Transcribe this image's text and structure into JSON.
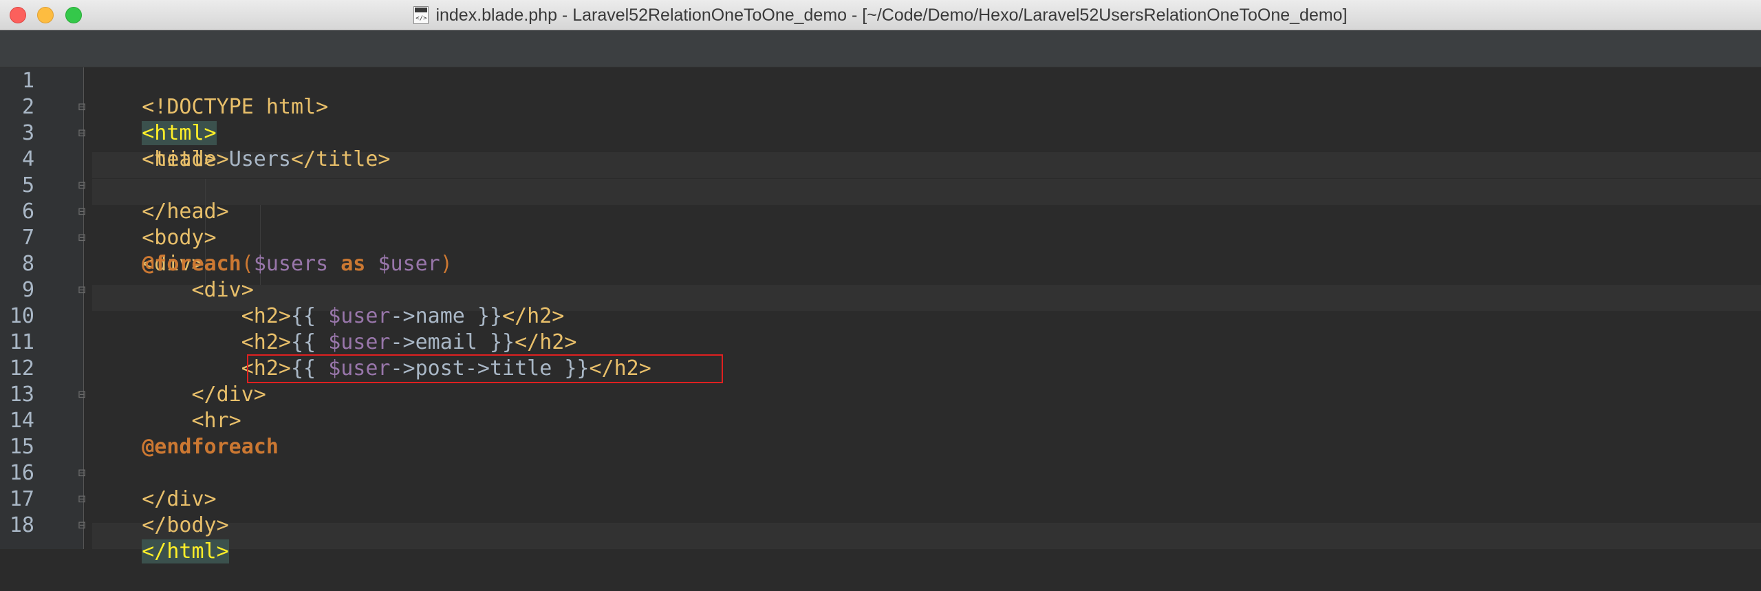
{
  "window": {
    "title": "index.blade.php - Laravel52RelationOneToOne_demo - [~/Code/Demo/Hexo/Laravel52UsersRelationOneToOne_demo]",
    "file_icon_label": "</>"
  },
  "editor": {
    "lines": [
      {
        "n": "1"
      },
      {
        "n": "2"
      },
      {
        "n": "3"
      },
      {
        "n": "4"
      },
      {
        "n": "5"
      },
      {
        "n": "6"
      },
      {
        "n": "7"
      },
      {
        "n": "8"
      },
      {
        "n": "9"
      },
      {
        "n": "10"
      },
      {
        "n": "11"
      },
      {
        "n": "12"
      },
      {
        "n": "13"
      },
      {
        "n": "14"
      },
      {
        "n": "15"
      },
      {
        "n": "16"
      },
      {
        "n": "17"
      },
      {
        "n": "18"
      }
    ],
    "code": {
      "l1": "<!DOCTYPE html>",
      "l2": "<html>",
      "l3": "<head>",
      "l4_open": "<title>",
      "l4_text": "Users",
      "l4_close": "</title>",
      "l5": "</head>",
      "l6": "<body>",
      "l7": "<div>",
      "l8_dir": "@foreach",
      "l8_paren_open": "(",
      "l8_var1": "$users",
      "l8_kw": "as",
      "l8_var2": "$user",
      "l8_paren_close": ")",
      "l9": "<div>",
      "l10_open": "<h2>",
      "l10_brace_open": "{{ ",
      "l10_var": "$user",
      "l10_rest": "->name }}",
      "l10_close": "</h2>",
      "l11_open": "<h2>",
      "l11_brace_open": "{{ ",
      "l11_var": "$user",
      "l11_rest": "->email }}",
      "l11_close": "</h2>",
      "l12_open": "<h2>",
      "l12_brace_open": "{{ ",
      "l12_var": "$user",
      "l12_rest": "->post->title }}",
      "l12_close": "</h2>",
      "l13": "</div>",
      "l14": "<hr>",
      "l15": "@endforeach",
      "l16": "</div>",
      "l17": "</body>",
      "l18": "</html>"
    }
  },
  "colors": {
    "tag": "#e8bf6a",
    "directive": "#cc7832",
    "variable": "#9876aa",
    "text": "#a9b7c6",
    "background": "#2b2b2b",
    "highlight_box": "#e02020"
  }
}
